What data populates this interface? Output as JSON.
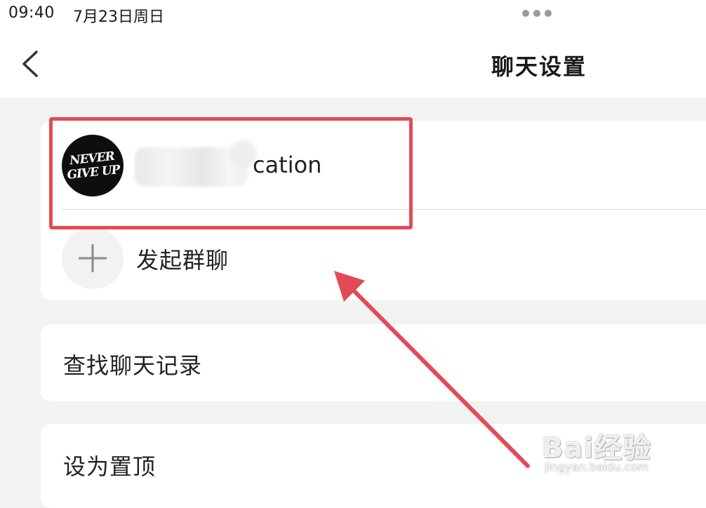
{
  "status_bar": {
    "time": "09:40",
    "date": "7月23日周日"
  },
  "nav": {
    "title": "聊天设置",
    "back_icon": "chevron-left-icon"
  },
  "members": {
    "avatar_text_lines": [
      "NEVER",
      "GIVE UP"
    ],
    "name_visible_suffix": "cation",
    "add_label": "发起群聊",
    "add_icon": "plus-icon"
  },
  "settings": {
    "search_history_label": "查找聊天记录",
    "pin_label": "设为置顶"
  },
  "annotation": {
    "highlight_color": "#e24b55"
  },
  "watermark": {
    "logo": "Bai经验",
    "url": "jingyan.baidu.com"
  }
}
